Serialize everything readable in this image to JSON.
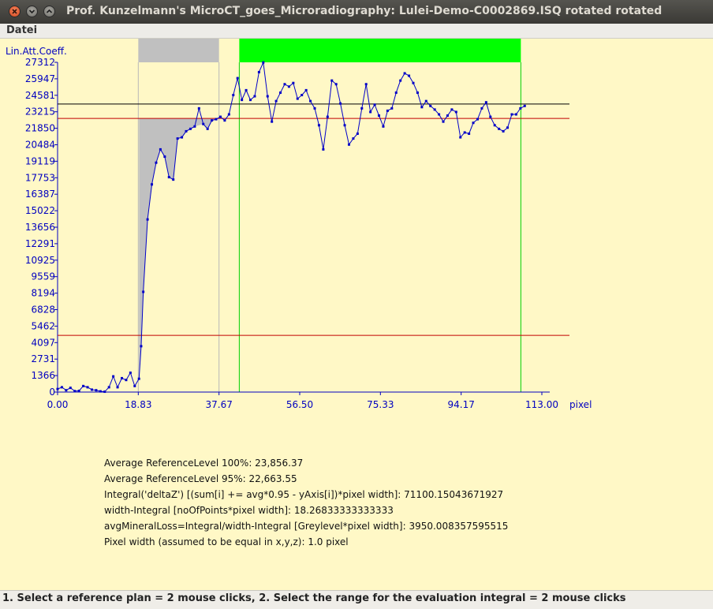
{
  "window": {
    "title": "Prof. Kunzelmann's MicroCT_goes_Microradiography:  Lulei-Demo-C0002869.ISQ rotated rotated"
  },
  "menu": {
    "items": [
      "Datei"
    ]
  },
  "colors": {
    "background": "#fff8c6",
    "axis": "#0000c0",
    "series": "#0000c8",
    "reference_line": "#000000",
    "threshold_line": "#c00000",
    "reference_range": "#c0c0c0",
    "evaluation_range": "#00ff00"
  },
  "chart_data": {
    "type": "line",
    "ylabel": "Lin.Att.Coeff.",
    "xlabel": "pixel",
    "x_ticks": [
      "0.00",
      "18.83",
      "37.67",
      "56.50",
      "75.33",
      "94.17",
      "113.00"
    ],
    "x_tick_values": [
      0,
      18.83,
      37.67,
      56.5,
      75.33,
      94.17,
      113.0
    ],
    "y_ticks": [
      "0",
      "1366",
      "2731",
      "4097",
      "5462",
      "6828",
      "8194",
      "9559",
      "10925",
      "12291",
      "13656",
      "15022",
      "16387",
      "17753",
      "19119",
      "20484",
      "21850",
      "23215",
      "24581",
      "25947",
      "27312"
    ],
    "y_tick_values": [
      0,
      1366,
      2731,
      4097,
      5462,
      6828,
      8194,
      9559,
      10925,
      12291,
      13656,
      15022,
      16387,
      17753,
      19119,
      20484,
      21850,
      23215,
      24581,
      25947,
      27312
    ],
    "xlim": [
      0,
      113
    ],
    "ylim": [
      0,
      27312
    ],
    "reference_level_100": 23856.37,
    "reference_level_95": 22663.55,
    "lower_threshold": 4700,
    "reference_range_x": [
      18.83,
      37.67
    ],
    "evaluation_range_x": [
      42.4,
      108.1
    ],
    "series": [
      {
        "x": [
          0,
          1,
          2,
          3,
          4,
          5,
          6,
          7,
          8,
          9,
          10,
          11,
          12,
          13,
          14,
          15,
          16,
          17,
          18,
          19,
          19.5,
          20,
          21,
          22,
          23,
          24,
          25,
          26,
          27,
          28,
          29,
          30,
          31,
          32,
          33,
          34,
          35,
          36,
          37,
          38,
          39,
          40,
          41,
          42,
          43,
          44,
          45,
          46,
          47,
          48,
          49,
          50,
          51,
          52,
          53,
          54,
          55,
          56,
          57,
          58,
          59,
          60,
          61,
          62,
          63,
          64,
          65,
          66,
          67,
          68,
          69,
          70,
          71,
          72,
          73,
          74,
          75,
          76,
          77,
          78,
          79,
          80,
          81,
          82,
          83,
          84,
          85,
          86,
          87,
          88,
          89,
          90,
          91,
          92,
          93,
          94,
          95,
          96,
          97,
          98,
          99,
          100,
          101,
          102,
          103,
          104,
          105,
          106,
          107,
          108,
          109
        ],
        "y": [
          250,
          400,
          150,
          350,
          80,
          100,
          500,
          400,
          200,
          150,
          60,
          30,
          400,
          1300,
          400,
          1150,
          1000,
          1600,
          500,
          1100,
          3800,
          8300,
          14300,
          17200,
          19000,
          20100,
          19500,
          17800,
          17600,
          21000,
          21100,
          21600,
          21800,
          22000,
          23500,
          22200,
          21800,
          22500,
          22600,
          22800,
          22500,
          23000,
          24600,
          26000,
          24200,
          25000,
          24200,
          24500,
          26500,
          27300,
          24500,
          22400,
          24100,
          24800,
          25500,
          25300,
          25600,
          24300,
          24600,
          25000,
          24100,
          23500,
          22100,
          20100,
          22800,
          25800,
          25500,
          23900,
          22100,
          20500,
          21000,
          21400,
          23500,
          25500,
          23200,
          23800,
          22900,
          22000,
          23300,
          23500,
          24800,
          25800,
          26400,
          26200,
          25600,
          24800,
          23600,
          24100,
          23700,
          23400,
          23000,
          22400,
          22900,
          23400,
          23200,
          21100,
          21500,
          21400,
          22300,
          22600,
          23500,
          24000,
          22800,
          22100,
          21800,
          21600,
          21900,
          23000,
          23000,
          23500,
          23700
        ]
      }
    ]
  },
  "stats": {
    "line1": "Average ReferenceLevel 100%: 23,856.37",
    "line2": "Average ReferenceLevel  95%: 22,663.55",
    "line3": "Integral('deltaZ') [(sum[i] += avg*0.95 - yAxis[i])*pixel width]: 71100.15043671927",
    "line4": "width-Integral [noOfPoints*pixel width]: 18.26833333333333",
    "line5": "avgMineralLoss=Integral/width-Integral [Greylevel*pixel width]: 3950.008357595515",
    "line6": "Pixel width (assumed to be equal in x,y,z): 1.0 pixel"
  },
  "status": {
    "text": "1. Select a reference plan = 2 mouse clicks, 2. Select the range for the evaluation integral = 2 mouse clicks"
  }
}
